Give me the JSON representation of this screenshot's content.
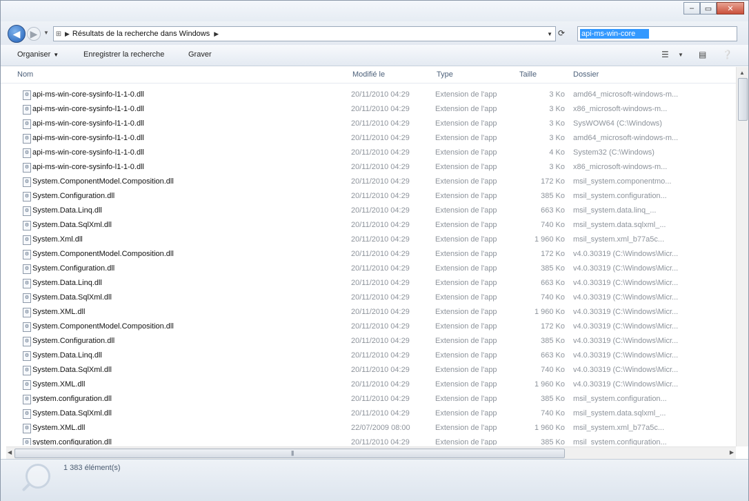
{
  "address": {
    "breadcrumb": "Résultats de la recherche dans Windows",
    "search_query": "api-ms-win-core"
  },
  "commandbar": {
    "organize": "Organiser",
    "save_search": "Enregistrer la recherche",
    "burn": "Graver"
  },
  "columns": {
    "name": "Nom",
    "date": "Modifié le",
    "type": "Type",
    "size": "Taille",
    "folder": "Dossier"
  },
  "files": [
    {
      "name": "api-ms-win-core-sysinfo-l1-1-0.dll",
      "date": "20/11/2010 04:29",
      "type": "Extension de l'app",
      "size": "3 Ko",
      "folder": "amd64_microsoft-windows-m..."
    },
    {
      "name": "api-ms-win-core-sysinfo-l1-1-0.dll",
      "date": "20/11/2010 04:29",
      "type": "Extension de l'app",
      "size": "3 Ko",
      "folder": "x86_microsoft-windows-m..."
    },
    {
      "name": "api-ms-win-core-sysinfo-l1-1-0.dll",
      "date": "20/11/2010 04:29",
      "type": "Extension de l'app",
      "size": "3 Ko",
      "folder": "SysWOW64 (C:\\Windows)"
    },
    {
      "name": "api-ms-win-core-sysinfo-l1-1-0.dll",
      "date": "20/11/2010 04:29",
      "type": "Extension de l'app",
      "size": "3 Ko",
      "folder": "amd64_microsoft-windows-m..."
    },
    {
      "name": "api-ms-win-core-sysinfo-l1-1-0.dll",
      "date": "20/11/2010 04:29",
      "type": "Extension de l'app",
      "size": "4 Ko",
      "folder": "System32 (C:\\Windows)"
    },
    {
      "name": "api-ms-win-core-sysinfo-l1-1-0.dll",
      "date": "20/11/2010 04:29",
      "type": "Extension de l'app",
      "size": "3 Ko",
      "folder": "x86_microsoft-windows-m..."
    },
    {
      "name": "System.ComponentModel.Composition.dll",
      "date": "20/11/2010 04:29",
      "type": "Extension de l'app",
      "size": "172 Ko",
      "folder": "msil_system.componentmo..."
    },
    {
      "name": "System.Configuration.dll",
      "date": "20/11/2010 04:29",
      "type": "Extension de l'app",
      "size": "385 Ko",
      "folder": "msil_system.configuration..."
    },
    {
      "name": "System.Data.Linq.dll",
      "date": "20/11/2010 04:29",
      "type": "Extension de l'app",
      "size": "663 Ko",
      "folder": "msil_system.data.linq_..."
    },
    {
      "name": "System.Data.SqlXml.dll",
      "date": "20/11/2010 04:29",
      "type": "Extension de l'app",
      "size": "740 Ko",
      "folder": "msil_system.data.sqlxml_..."
    },
    {
      "name": "System.Xml.dll",
      "date": "20/11/2010 04:29",
      "type": "Extension de l'app",
      "size": "1 960 Ko",
      "folder": "msil_system.xml_b77a5c..."
    },
    {
      "name": "System.ComponentModel.Composition.dll",
      "date": "20/11/2010 04:29",
      "type": "Extension de l'app",
      "size": "172 Ko",
      "folder": "v4.0.30319 (C:\\Windows\\Micr..."
    },
    {
      "name": "System.Configuration.dll",
      "date": "20/11/2010 04:29",
      "type": "Extension de l'app",
      "size": "385 Ko",
      "folder": "v4.0.30319 (C:\\Windows\\Micr..."
    },
    {
      "name": "System.Data.Linq.dll",
      "date": "20/11/2010 04:29",
      "type": "Extension de l'app",
      "size": "663 Ko",
      "folder": "v4.0.30319 (C:\\Windows\\Micr..."
    },
    {
      "name": "System.Data.SqlXml.dll",
      "date": "20/11/2010 04:29",
      "type": "Extension de l'app",
      "size": "740 Ko",
      "folder": "v4.0.30319 (C:\\Windows\\Micr..."
    },
    {
      "name": "System.XML.dll",
      "date": "20/11/2010 04:29",
      "type": "Extension de l'app",
      "size": "1 960 Ko",
      "folder": "v4.0.30319 (C:\\Windows\\Micr..."
    },
    {
      "name": "System.ComponentModel.Composition.dll",
      "date": "20/11/2010 04:29",
      "type": "Extension de l'app",
      "size": "172 Ko",
      "folder": "v4.0.30319 (C:\\Windows\\Micr..."
    },
    {
      "name": "System.Configuration.dll",
      "date": "20/11/2010 04:29",
      "type": "Extension de l'app",
      "size": "385 Ko",
      "folder": "v4.0.30319 (C:\\Windows\\Micr..."
    },
    {
      "name": "System.Data.Linq.dll",
      "date": "20/11/2010 04:29",
      "type": "Extension de l'app",
      "size": "663 Ko",
      "folder": "v4.0.30319 (C:\\Windows\\Micr..."
    },
    {
      "name": "System.Data.SqlXml.dll",
      "date": "20/11/2010 04:29",
      "type": "Extension de l'app",
      "size": "740 Ko",
      "folder": "v4.0.30319 (C:\\Windows\\Micr..."
    },
    {
      "name": "System.XML.dll",
      "date": "20/11/2010 04:29",
      "type": "Extension de l'app",
      "size": "1 960 Ko",
      "folder": "v4.0.30319 (C:\\Windows\\Micr..."
    },
    {
      "name": "system.configuration.dll",
      "date": "20/11/2010 04:29",
      "type": "Extension de l'app",
      "size": "385 Ko",
      "folder": "msil_system.configuration..."
    },
    {
      "name": "System.Data.SqlXml.dll",
      "date": "20/11/2010 04:29",
      "type": "Extension de l'app",
      "size": "740 Ko",
      "folder": "msil_system.data.sqlxml_..."
    },
    {
      "name": "System.XML.dll",
      "date": "22/07/2009 08:00",
      "type": "Extension de l'app",
      "size": "1 960 Ko",
      "folder": "msil_system.xml_b77a5c..."
    },
    {
      "name": "system.configuration.dll",
      "date": "20/11/2010 04:29",
      "type": "Extension de l'app",
      "size": "385 Ko",
      "folder": "msil_system.configuration..."
    }
  ],
  "details": {
    "count": "1 383 élément(s)"
  }
}
